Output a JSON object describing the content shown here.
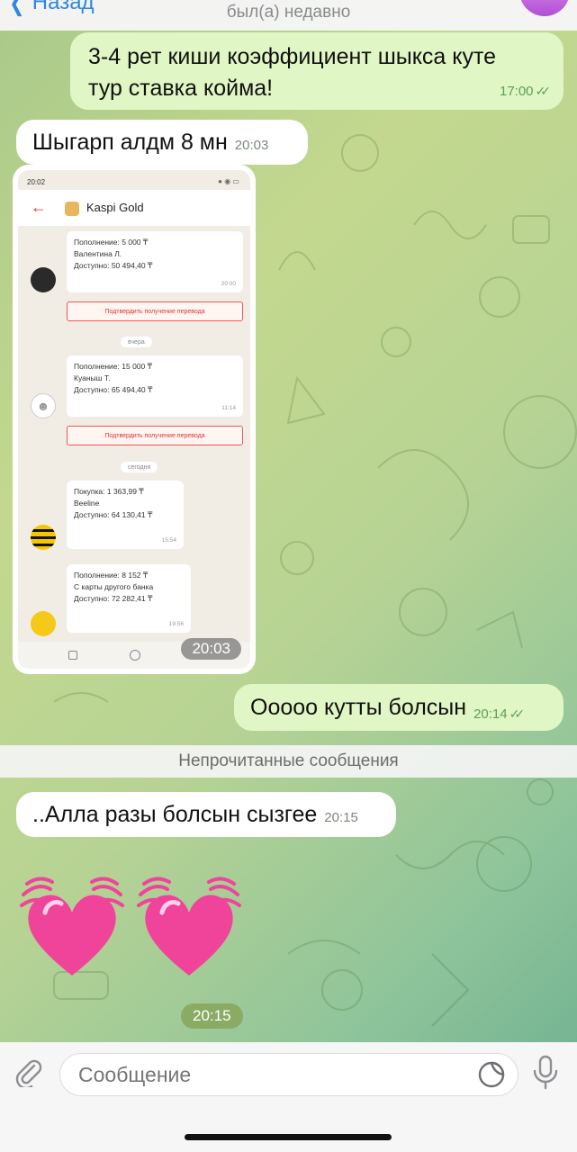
{
  "header": {
    "back_label": "Назад",
    "status": "был(а) недавно"
  },
  "messages": [
    {
      "id": "m1",
      "direction": "out",
      "text_line1": "3-4 рет киши коэффициент шыкса куте",
      "text_line2": "тур ставка койма!",
      "time": "17:00"
    },
    {
      "id": "m2",
      "direction": "in",
      "text": "Шыгарп алдм 8 мн",
      "time": "20:03"
    },
    {
      "id": "m3",
      "direction": "in",
      "type": "image",
      "time": "20:03"
    },
    {
      "id": "m4",
      "direction": "out",
      "text": "Ооооо кутты болсын",
      "time": "20:14"
    },
    {
      "id": "m5",
      "direction": "in",
      "text": "..Алла разы болсын сызгее",
      "time": "20:15"
    },
    {
      "id": "m6",
      "direction": "in",
      "type": "emoji",
      "time": "20:15"
    }
  ],
  "unread_divider": "Непрочитанные сообщения",
  "screenshot": {
    "status_time": "20:02",
    "app_title": "Kaspi Gold",
    "transactions": [
      {
        "line1": "Пополнение: 5 000 ₸",
        "line2": "Валентина Л.",
        "line3": "Доступно: 50 494,40 ₸",
        "time": "20:00"
      },
      {
        "line1": "Пополнение: 15 000 ₸",
        "line2": "Куаныш Т.",
        "line3": "Доступно: 65 494,40 ₸",
        "time": "11:14"
      },
      {
        "line1": "Покупка: 1 363,99 ₸",
        "line2": "Beeline",
        "line3": "Доступно: 64 130,41 ₸",
        "time": "15:54"
      },
      {
        "line1": "Пополнение: 8 152 ₸",
        "line2": "С карты другого банка",
        "line3": "Доступно: 72 282,41 ₸",
        "time": "19:56"
      }
    ],
    "confirm_label": "Подтвердить получение перевода",
    "day_yesterday": "вчера",
    "day_today": "сегодня"
  },
  "composer": {
    "placeholder": "Сообщение"
  },
  "colors": {
    "outgoing_bubble": "#e1f6c5",
    "incoming_bubble": "#ffffff",
    "accent_blue": "#2f86e0",
    "check_green": "#5aa056",
    "heart_pink": "#f0449b"
  },
  "icons": [
    "chevron-left-icon",
    "double-check-icon",
    "attach-icon",
    "sticker-icon",
    "mic-icon",
    "heart-icon"
  ]
}
